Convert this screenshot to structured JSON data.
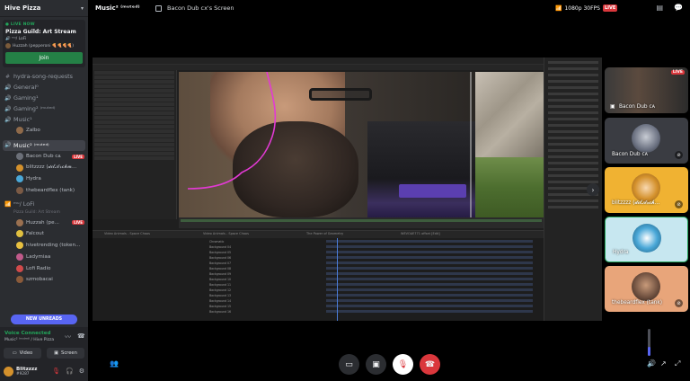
{
  "server": {
    "name": "Hive Pizza",
    "menu_icon": "chevron-down-icon"
  },
  "stage": {
    "live_label": "LIVE NOW",
    "title": "Pizza Guild: Art Stream",
    "topic": "ᵐᵘ/ LoFi",
    "speaker": "Huzzah (pepperoni 🍕🍕🍕🍕)"
  },
  "join_label": "Join",
  "channels": [
    {
      "name": "hydra-song-requests",
      "kind": "text"
    },
    {
      "name": "General⁰",
      "kind": "voice"
    },
    {
      "name": "Gaming¹",
      "kind": "voice"
    },
    {
      "name": "Gaming² ⁽ᵐᵘᵗᵉᵈ⁾",
      "kind": "voice"
    },
    {
      "name": "Music¹",
      "kind": "voice"
    }
  ],
  "music1_members": [
    {
      "name": "Zalbo"
    }
  ],
  "active_channel": {
    "name": "Music² ⁽ᵐᵘᵗᵉᵈ⁾"
  },
  "music2_members": [
    {
      "name": "Bacon Dub ᴄᴀ",
      "live": "LIVE"
    },
    {
      "name": "blitzzzz (𝓭𝓲𝓵𝓐𝓻𝓬𝓱𝓶..."
    },
    {
      "name": "Hydra"
    },
    {
      "name": "thebeardflex (tank)"
    }
  ],
  "stage_channel": {
    "name": "ᵐᵘ/ LoFi",
    "sub": "Pizza Guild: Art Stream"
  },
  "stage_members": [
    {
      "name": "Huzzah (pe...",
      "live": "LIVE"
    },
    {
      "name": "Falcout"
    },
    {
      "name": "hivetrending (token..."
    },
    {
      "name": "Ladymiaa"
    },
    {
      "name": "Lofi Radio"
    },
    {
      "name": "szmobacai"
    }
  ],
  "new_unreads": "NEW UNREADS",
  "voice": {
    "status": "Voice Connected",
    "location": "Music² ⁽ᵐᵘᵗᵉᵈ⁾ / Hive Pizza",
    "video_label": "Video",
    "screen_label": "Screen"
  },
  "user": {
    "name": "Blitzzzz",
    "tag": "#9287"
  },
  "topbar": {
    "channel": "Music² ⁽ᵐᵘᵗᵉᵈ⁾",
    "screen_title": "Bacon Dub cx's Screen",
    "quality": "1080p 30FPS",
    "live": "LIVE"
  },
  "tiles": [
    {
      "name": "",
      "live": "LIVE"
    },
    {
      "name": "Bacon Dub ᴄᴀ",
      "color": "#313338"
    },
    {
      "name": "blitzzzz (𝓭𝓲𝓵𝓐𝓻𝓬𝓱...",
      "color": "#f0b232"
    },
    {
      "name": "Hydra",
      "color": "#c7e7f0"
    },
    {
      "name": "thebeardflex (tank)",
      "color": "#e8a57a"
    }
  ],
  "stream_app": {
    "tabs": [
      "Render Queue",
      "Hello World",
      "Spooky Dreaming"
    ],
    "comp_tabs": [
      "Video Animals - Space Chaos",
      "Video Animals - Space Chaos",
      "The Power of Geometry",
      "WEVOAE771 offset [Edit]"
    ],
    "layers": [
      "Chromatic",
      "Background 04",
      "Background 05",
      "Background 06",
      "Background 07",
      "Background 08",
      "Background 09",
      "Background 10",
      "Background 11",
      "Background 12",
      "Background 13",
      "Background 14",
      "Background 15",
      "Background 16"
    ]
  },
  "volume_level": 0.35
}
